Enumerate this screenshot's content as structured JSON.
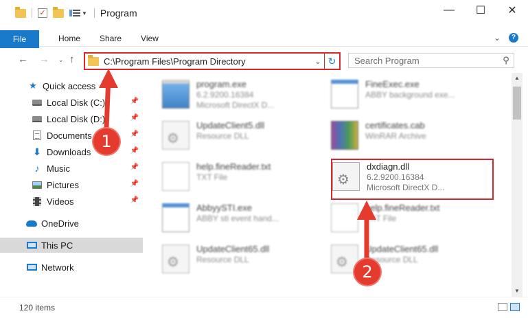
{
  "window": {
    "title": "Program",
    "controls": {
      "minimize": "—",
      "maximize": "☐",
      "close": "✕"
    }
  },
  "ribbon": {
    "tabs": [
      "File",
      "Home",
      "Share",
      "View"
    ],
    "expand_icon": "chevron-down-icon",
    "help_icon": "?"
  },
  "address_bar": {
    "path": "C:\\Program Files\\Program Directory",
    "dropdown": "⌄",
    "refresh": "↻"
  },
  "search": {
    "placeholder": "Search Program"
  },
  "sidebar": {
    "items": [
      {
        "label": "Quick access",
        "icon": "star-icon",
        "pinned": false
      },
      {
        "label": "Local Disk (C:)",
        "icon": "drive-icon",
        "pinned": true
      },
      {
        "label": "Local Disk (D:)",
        "icon": "drive-icon",
        "pinned": true
      },
      {
        "label": "Documents",
        "icon": "documents-icon",
        "pinned": true
      },
      {
        "label": "Downloads",
        "icon": "downloads-icon",
        "pinned": true
      },
      {
        "label": "Music",
        "icon": "music-icon",
        "pinned": true
      },
      {
        "label": "Pictures",
        "icon": "pictures-icon",
        "pinned": true
      },
      {
        "label": "Videos",
        "icon": "videos-icon",
        "pinned": true
      },
      {
        "label": "OneDrive",
        "icon": "onedrive-icon",
        "pinned": false
      },
      {
        "label": "This PC",
        "icon": "this-pc-icon",
        "pinned": false,
        "selected": true
      },
      {
        "label": "Network",
        "icon": "network-icon",
        "pinned": false
      }
    ]
  },
  "files": [
    {
      "name": "program.exe",
      "line2": "6.2.9200.16384",
      "line3": "Microsoft DirectX D...",
      "type": "exe"
    },
    {
      "name": "FineExec.exe",
      "line2": "ABBY background exe...",
      "line3": "",
      "type": "app"
    },
    {
      "name": "UpdateClient5.dll",
      "line2": "Resource DLL",
      "line3": "",
      "type": "dll"
    },
    {
      "name": "certificates.cab",
      "line2": "WinRAR Archive",
      "line3": "",
      "type": "rar"
    },
    {
      "name": "help.fineReader.txt",
      "line2": "TXT File",
      "line3": "",
      "type": "txt"
    },
    {
      "name": "dxdiagn.dll",
      "line2": "6.2.9200.16384",
      "line3": "Microsoft DirectX D...",
      "type": "dll",
      "highlighted": true
    },
    {
      "name": "AbbyySTI.exe",
      "line2": "ABBY sti event hand...",
      "line3": "",
      "type": "app"
    },
    {
      "name": "help.fineReader.txt",
      "line2": "TXT File",
      "line3": "",
      "type": "txt"
    },
    {
      "name": "UpdateClient65.dll",
      "line2": "Resource DLL",
      "line3": "",
      "type": "dll"
    },
    {
      "name": "UpdateClient65.dll",
      "line2": "Resource DLL",
      "line3": "",
      "type": "dll"
    }
  ],
  "status": {
    "item_count": "120 items"
  },
  "callouts": [
    "1",
    "2"
  ],
  "colors": {
    "accent": "#1979ca",
    "highlight": "#d8272a",
    "callout": "#e53b2f"
  }
}
